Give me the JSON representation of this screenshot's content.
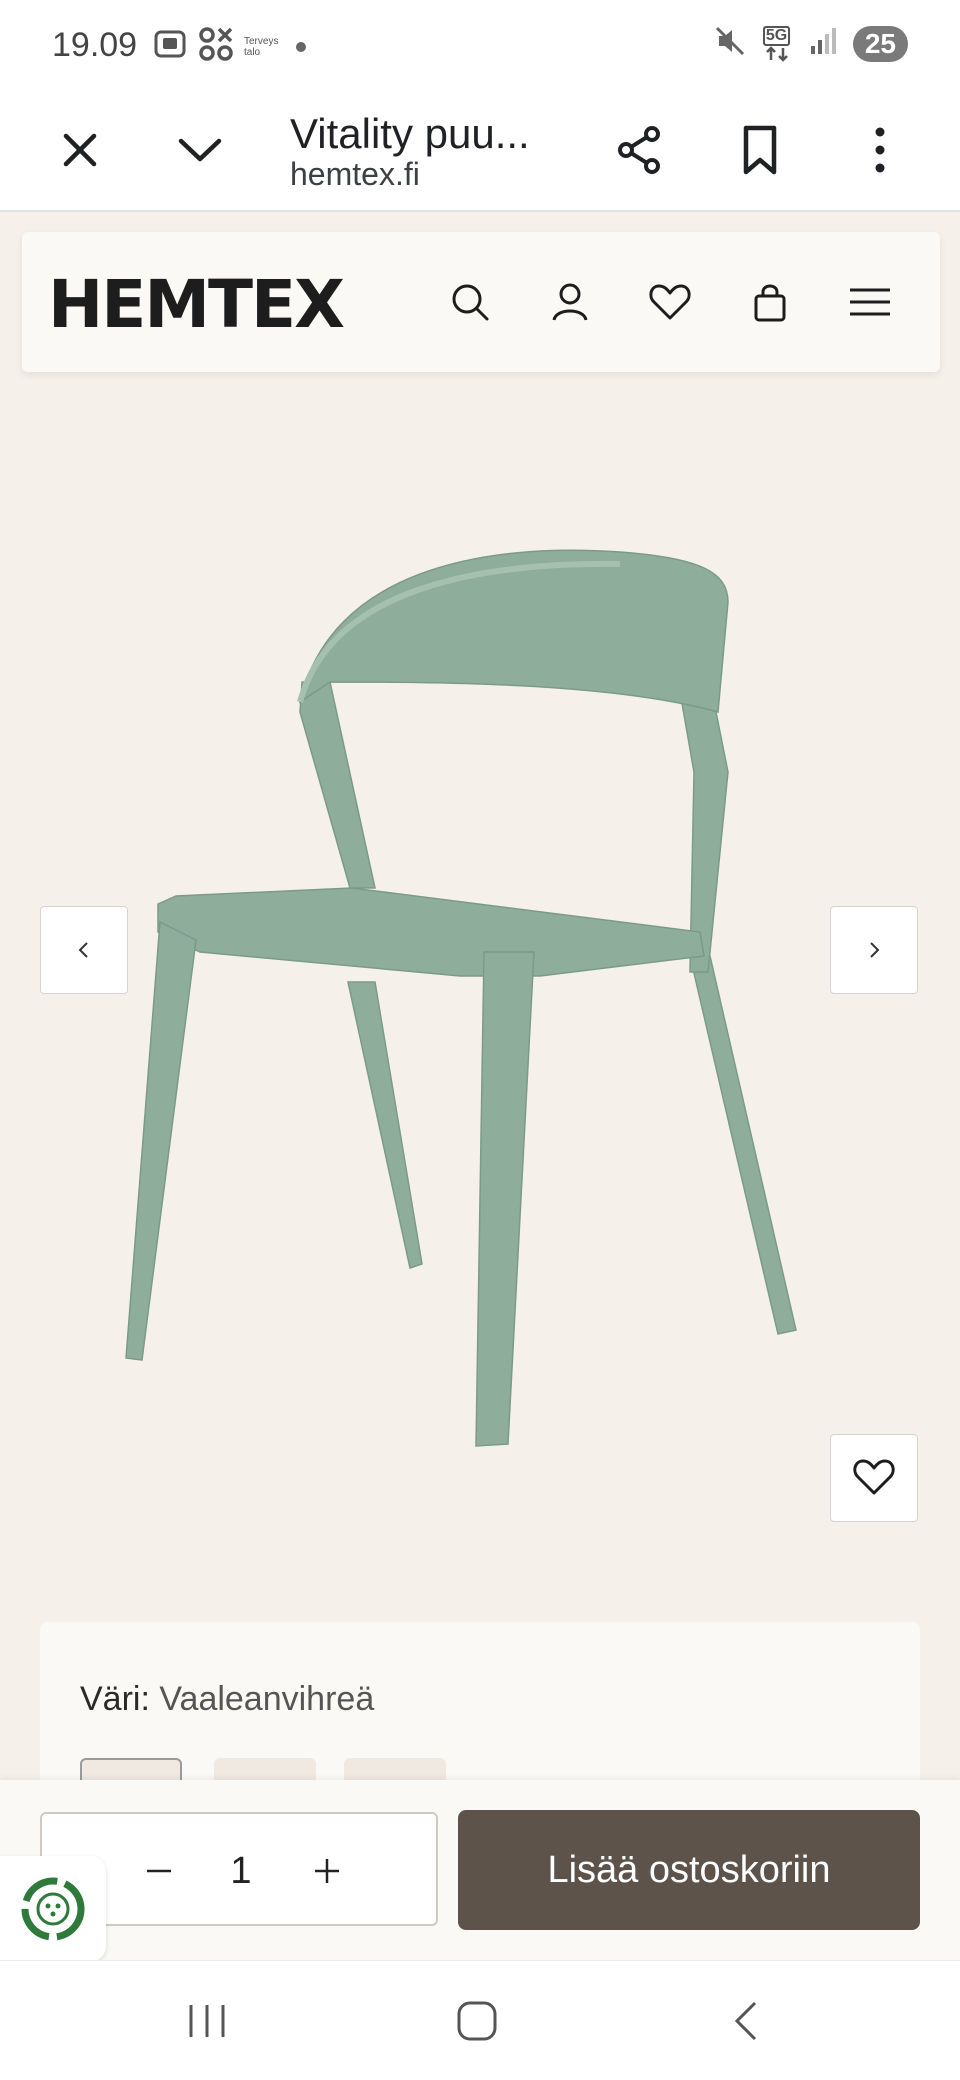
{
  "status_bar": {
    "time": "19.09",
    "mini_label": "Terveys talo",
    "battery": "25",
    "network": "5G"
  },
  "browser": {
    "title": "Vitality puu...",
    "url": "hemtex.fi"
  },
  "site": {
    "logo": "HEMTEX"
  },
  "product": {
    "color_label": "Väri:",
    "color_value": "Vaaleanvihreä",
    "chair_color": "#8fad9b",
    "swatches": [
      "#8fad9b",
      "#e3b5a7",
      "#8b7a62"
    ]
  },
  "purchase": {
    "quantity": "1",
    "add_to_cart": "Lisää ostoskoriin",
    "button_color": "#5e534b"
  },
  "colors": {
    "page_bg": "#f5f1ea",
    "header_bg": "#fbf9f5"
  }
}
